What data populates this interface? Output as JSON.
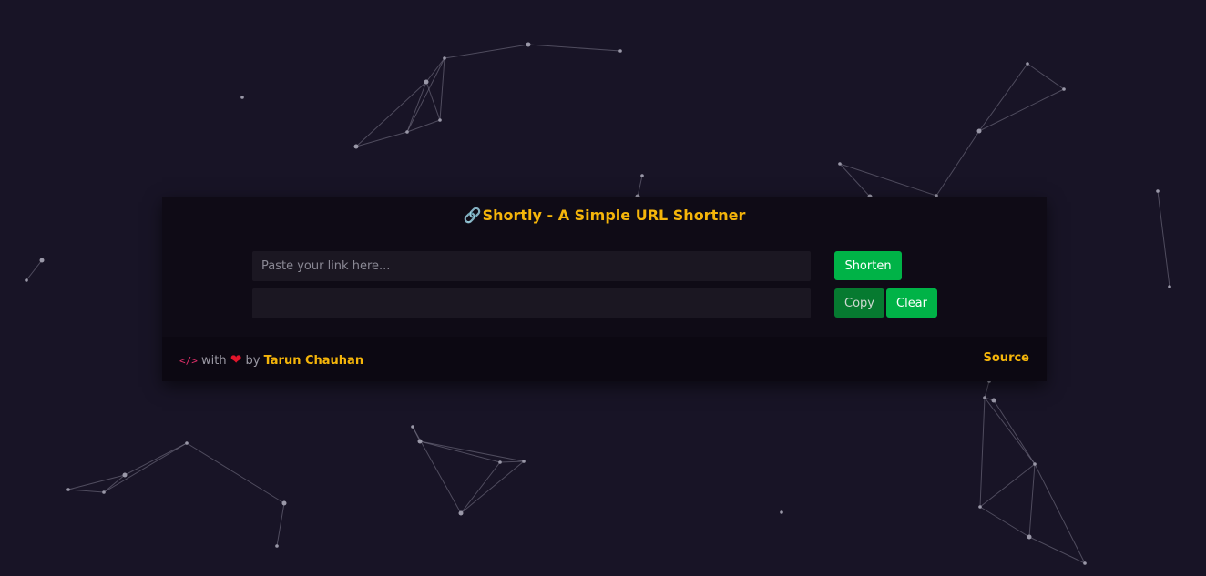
{
  "app": {
    "title_icon": "🔗",
    "title": "Shortly - A Simple URL Shortner"
  },
  "form": {
    "url_input": {
      "placeholder": "Paste your link here...",
      "value": ""
    },
    "short_output": {
      "placeholder": "",
      "value": ""
    },
    "shorten_label": "Shorten",
    "copy_label": "Copy",
    "clear_label": "Clear"
  },
  "footer": {
    "code_icon": "</>",
    "with_text": "with",
    "heart_icon": "❤",
    "by_text": "by",
    "author": "Tarun Chauhan",
    "source_label": "Source"
  },
  "colors": {
    "background": "#181426",
    "card": "#0f0b16",
    "accent_yellow": "#f5b50a",
    "button_green": "#00b347",
    "button_green_dim": "#067a30",
    "heart_red": "#e3152b",
    "code_pink": "#e0306a"
  }
}
